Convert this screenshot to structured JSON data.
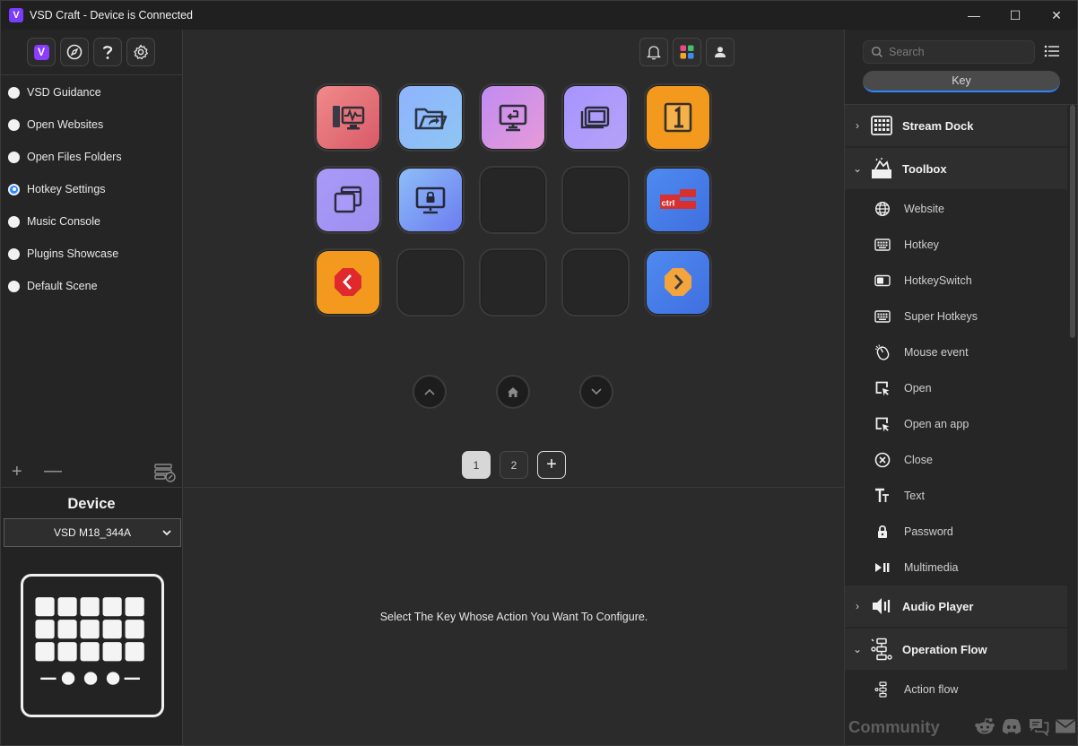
{
  "window": {
    "title": "VSD Craft - Device is Connected",
    "logo_letter": "V"
  },
  "window_controls": {
    "minimize": "—",
    "maximize": "☐",
    "close": "✕"
  },
  "profiles": [
    {
      "label": "VSD Guidance",
      "selected": false
    },
    {
      "label": "Open Websites",
      "selected": false
    },
    {
      "label": "Open Files Folders",
      "selected": false
    },
    {
      "label": "Hotkey Settings",
      "selected": true
    },
    {
      "label": "Music Console",
      "selected": false
    },
    {
      "label": "Plugins Showcase",
      "selected": false
    },
    {
      "label": "Default Scene",
      "selected": false
    }
  ],
  "profile_tools": {
    "add": "+",
    "remove": "—"
  },
  "device": {
    "title": "Device",
    "selected": "VSD M18_344A"
  },
  "pager": {
    "pages": [
      "1",
      "2"
    ],
    "active": "1",
    "add": "+"
  },
  "config_hint": "Select The Key Whose Action You Want To Configure.",
  "search": {
    "placeholder": "Search"
  },
  "key_tab": "Key",
  "categories": {
    "stream_dock": "Stream Dock",
    "toolbox": "Toolbox",
    "audio_player": "Audio Player",
    "operation_flow": "Operation Flow"
  },
  "toolbox_items": [
    "Website",
    "Hotkey",
    "HotkeySwitch",
    "Super Hotkeys",
    "Mouse event",
    "Open",
    "Open an app",
    "Close",
    "Text",
    "Password",
    "Multimedia"
  ],
  "operation_flow_items": [
    "Action flow"
  ],
  "community": "Community",
  "colors": {
    "accent": "#2f86ff",
    "brand": "#8b3cff",
    "orange": "#f39a1e"
  }
}
